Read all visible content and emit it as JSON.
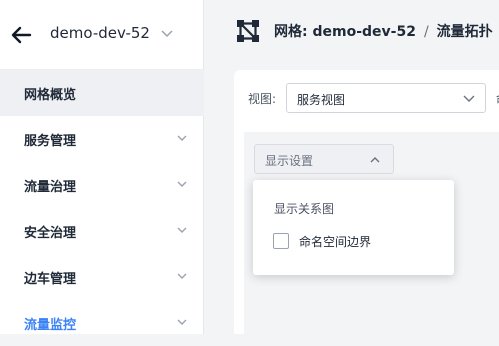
{
  "sidebar": {
    "mesh_name": "demo-dev-52",
    "items": [
      {
        "label": "网格概览"
      },
      {
        "label": "服务管理"
      },
      {
        "label": "流量治理"
      },
      {
        "label": "安全治理"
      },
      {
        "label": "边车管理"
      },
      {
        "label": "流量监控"
      }
    ]
  },
  "breadcrumb": {
    "prefix": "网格: demo-dev-52",
    "separator": "/",
    "current": "流量拓扑"
  },
  "view": {
    "label": "视图:",
    "selected": "服务视图",
    "next_label_partial": "命"
  },
  "display_settings": {
    "button_label": "显示设置",
    "dropdown_title": "显示关系图",
    "options": [
      {
        "label": "命名空间边界",
        "checked": false
      }
    ]
  },
  "colors": {
    "accent": "#3b82f6",
    "active_bg": "#eef0f4"
  },
  "icons": [
    "back-arrow-icon",
    "chevron-down-icon",
    "topology-icon",
    "chevron-up-icon"
  ]
}
